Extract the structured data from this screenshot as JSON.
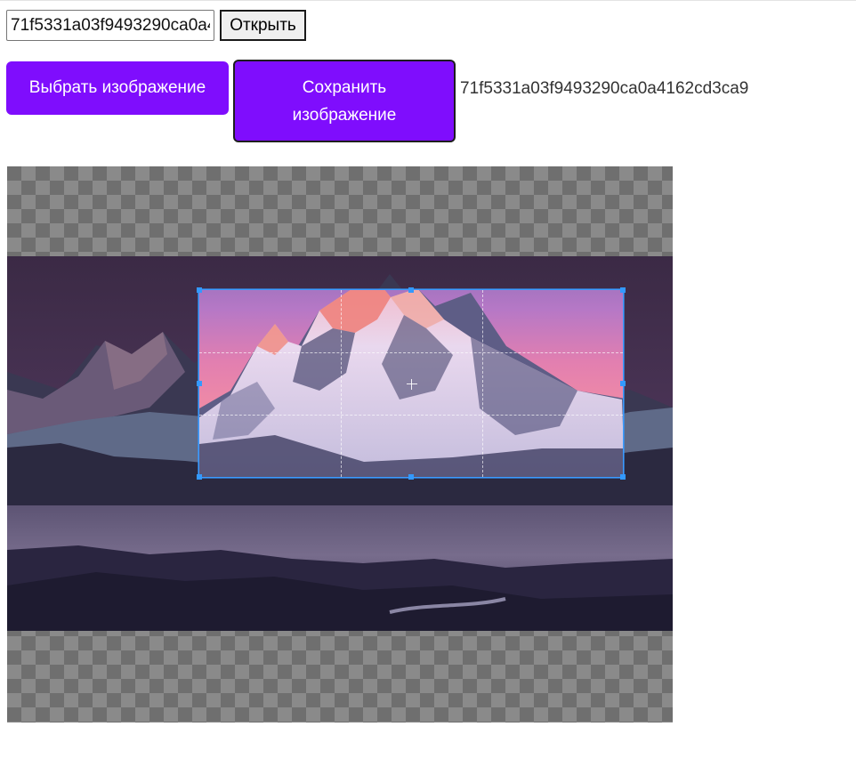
{
  "open_form": {
    "id_input_value": "71f5331a03f9493290ca0a4162cd3ca9",
    "open_label": "Открыть"
  },
  "toolbar": {
    "pick_label": "Выбрать изображение",
    "save_label": "Сохранить изображение",
    "image_id": "71f5331a03f9493290ca0a4162cd3ca9"
  },
  "colors": {
    "button_purple": "#7f0dfd",
    "crop_border": "#3399ff",
    "checker_dark": "#6f6f6f",
    "checker_light": "#8a8a8a"
  },
  "cropper": {
    "image": "mountain-sunset-photo",
    "crop_guides": "dashed-thirds"
  }
}
